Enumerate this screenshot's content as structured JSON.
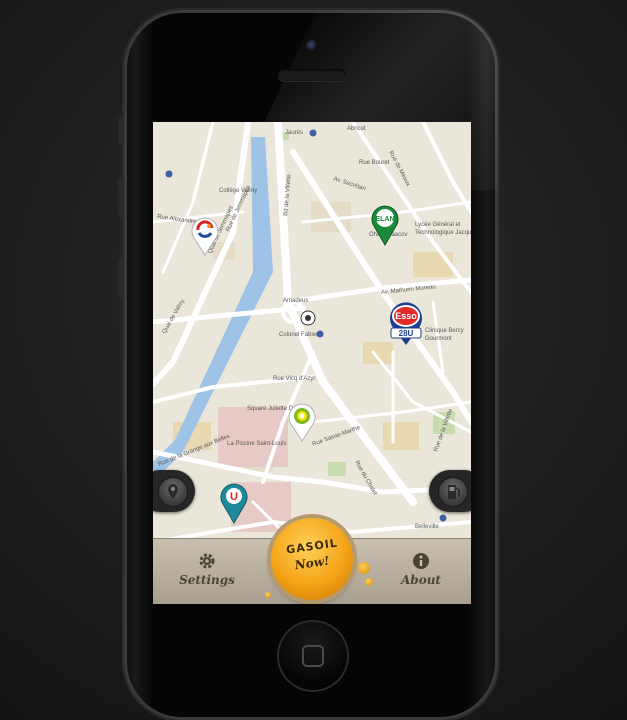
{
  "app": {
    "name": "Gasoil Now"
  },
  "map": {
    "streets": [
      "Jaurès",
      "Abricot",
      "Rue Bouret",
      "Rue de Meaux",
      "Av. Secrétan",
      "Collège Valmy",
      "Rue de Jemmapes",
      "Quai de Jemmapes",
      "Quai de Valmy",
      "Bd de la Villette",
      "Rue Alexandre Parodi",
      "Amadeus",
      "Colonel Fabien",
      "Av. Mathurin Moreau",
      "Rue Vicq d'Azyr",
      "Square Juliette Dodu",
      "La Piscine Saint-Louis",
      "Rue Sainte-Marthe",
      "Rue du Chalet",
      "Rue de la Grange aux Belles",
      "Lycée Général et Technologique Jacquard",
      "Ohalei Yaacov",
      "Belleville",
      "Rue de la Villette",
      "Clinique Bercy Gourmont"
    ]
  },
  "stations": [
    {
      "brand": "Total",
      "color": "#d7261e"
    },
    {
      "brand": "ELAN",
      "color": "#1a8a3a"
    },
    {
      "brand": "Esso",
      "color": "#1c3f8f",
      "badge": "28U"
    },
    {
      "brand": "BP",
      "color": "#7cb824"
    },
    {
      "brand": "U",
      "color": "#1d8a9c"
    }
  ],
  "controls": {
    "left_icon": "locate-icon",
    "right_icon": "fuel-icon"
  },
  "bottom_bar": {
    "settings_label": "Settings",
    "about_label": "About",
    "logo_line1": "GASOIL",
    "logo_line2": "Now!"
  }
}
